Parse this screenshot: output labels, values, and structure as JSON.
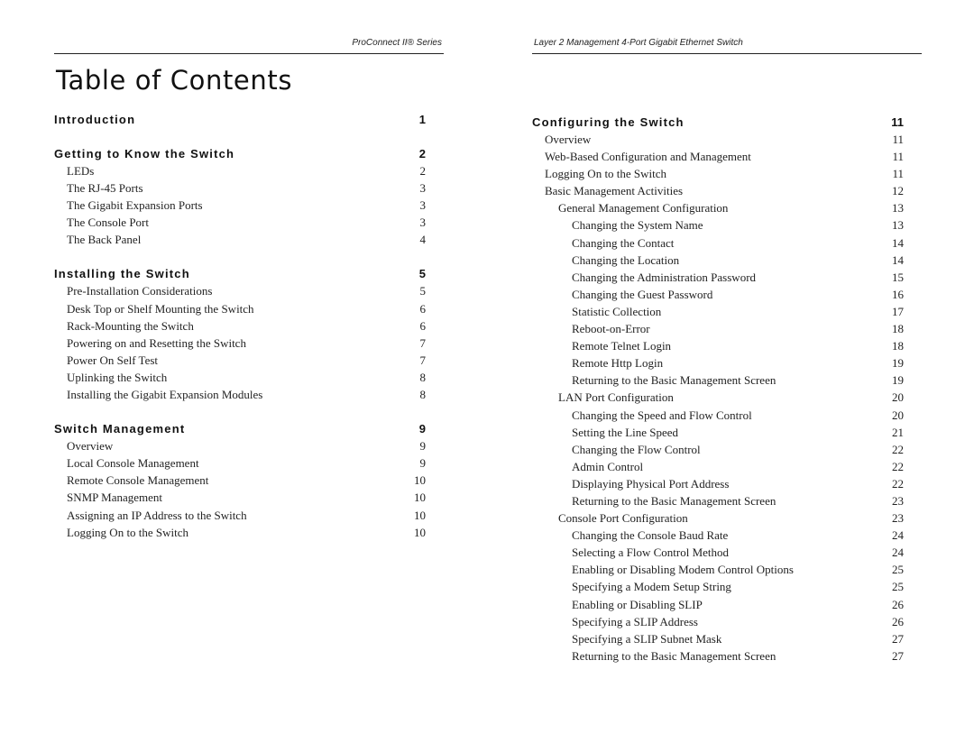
{
  "left_page": {
    "running_header": "ProConnect II® Series",
    "title": "Table of Contents",
    "sections": [
      {
        "title": "Introduction",
        "page": "1",
        "entries": []
      },
      {
        "title": "Getting to Know the Switch",
        "page": "2",
        "entries": [
          {
            "label": "LEDs",
            "page": "2",
            "level": 1
          },
          {
            "label": "The RJ-45 Ports",
            "page": "3",
            "level": 1
          },
          {
            "label": "The Gigabit Expansion Ports",
            "page": "3",
            "level": 1
          },
          {
            "label": "The Console Port",
            "page": "3",
            "level": 1
          },
          {
            "label": "The Back Panel",
            "page": "4",
            "level": 1
          }
        ]
      },
      {
        "title": "Installing the Switch",
        "page": "5",
        "entries": [
          {
            "label": "Pre-Installation Considerations",
            "page": "5",
            "level": 1
          },
          {
            "label": "Desk Top or Shelf Mounting the Switch",
            "page": "6",
            "level": 1
          },
          {
            "label": "Rack-Mounting the Switch",
            "page": "6",
            "level": 1
          },
          {
            "label": "Powering on and Resetting the Switch",
            "page": "7",
            "level": 1
          },
          {
            "label": "Power On Self Test",
            "page": "7",
            "level": 1
          },
          {
            "label": "Uplinking the Switch",
            "page": "8",
            "level": 1
          },
          {
            "label": "Installing the Gigabit Expansion Modules",
            "page": "8",
            "level": 1
          }
        ]
      },
      {
        "title": "Switch Management",
        "page": "9",
        "entries": [
          {
            "label": "Overview",
            "page": "9",
            "level": 1
          },
          {
            "label": "Local Console Management",
            "page": "9",
            "level": 1
          },
          {
            "label": "Remote Console Management",
            "page": "10",
            "level": 1
          },
          {
            "label": "SNMP Management",
            "page": "10",
            "level": 1
          },
          {
            "label": "Assigning an IP Address to the Switch",
            "page": "10",
            "level": 1
          },
          {
            "label": "Logging On to the Switch",
            "page": "10",
            "level": 1
          }
        ]
      }
    ]
  },
  "right_page": {
    "running_header": "Layer 2 Management 4-Port Gigabit Ethernet Switch",
    "sections": [
      {
        "title": "Configuring the Switch",
        "page": "11",
        "entries": [
          {
            "label": "Overview",
            "page": "11",
            "level": 1
          },
          {
            "label": "Web-Based Configuration and Management",
            "page": "11",
            "level": 1
          },
          {
            "label": "Logging On to the Switch",
            "page": "11",
            "level": 1
          },
          {
            "label": "Basic Management Activities",
            "page": "12",
            "level": 1
          },
          {
            "label": "General Management Configuration",
            "page": "13",
            "level": 2
          },
          {
            "label": "Changing the System Name",
            "page": "13",
            "level": 3
          },
          {
            "label": "Changing the Contact",
            "page": "14",
            "level": 3
          },
          {
            "label": "Changing the Location",
            "page": "14",
            "level": 3
          },
          {
            "label": "Changing the Administration Password",
            "page": "15",
            "level": 3
          },
          {
            "label": "Changing the Guest Password",
            "page": "16",
            "level": 3
          },
          {
            "label": "Statistic Collection",
            "page": "17",
            "level": 3
          },
          {
            "label": "Reboot-on-Error",
            "page": "18",
            "level": 3
          },
          {
            "label": "Remote Telnet Login",
            "page": "18",
            "level": 3
          },
          {
            "label": "Remote Http Login",
            "page": "19",
            "level": 3
          },
          {
            "label": "Returning to the Basic Management Screen",
            "page": "19",
            "level": 3
          },
          {
            "label": "LAN Port Configuration",
            "page": "20",
            "level": 2
          },
          {
            "label": "Changing the Speed and Flow Control",
            "page": "20",
            "level": 3
          },
          {
            "label": "Setting the Line Speed",
            "page": "21",
            "level": 3
          },
          {
            "label": "Changing the Flow Control",
            "page": "22",
            "level": 3
          },
          {
            "label": "Admin Control",
            "page": "22",
            "level": 3
          },
          {
            "label": "Displaying Physical Port Address",
            "page": "22",
            "level": 3
          },
          {
            "label": "Returning to the Basic Management Screen",
            "page": "23",
            "level": 3
          },
          {
            "label": "Console Port Configuration",
            "page": "23",
            "level": 2
          },
          {
            "label": "Changing the Console Baud Rate",
            "page": "24",
            "level": 3
          },
          {
            "label": "Selecting a Flow Control Method",
            "page": "24",
            "level": 3
          },
          {
            "label": "Enabling or Disabling Modem Control Options",
            "page": "25",
            "level": 3
          },
          {
            "label": "Specifying a Modem Setup String",
            "page": "25",
            "level": 3
          },
          {
            "label": "Enabling or Disabling SLIP",
            "page": "26",
            "level": 3
          },
          {
            "label": "Specifying a SLIP Address",
            "page": "26",
            "level": 3
          },
          {
            "label": "Specifying a SLIP Subnet Mask",
            "page": "27",
            "level": 3
          },
          {
            "label": "Returning to the Basic Management Screen",
            "page": "27",
            "level": 3
          }
        ]
      }
    ]
  }
}
